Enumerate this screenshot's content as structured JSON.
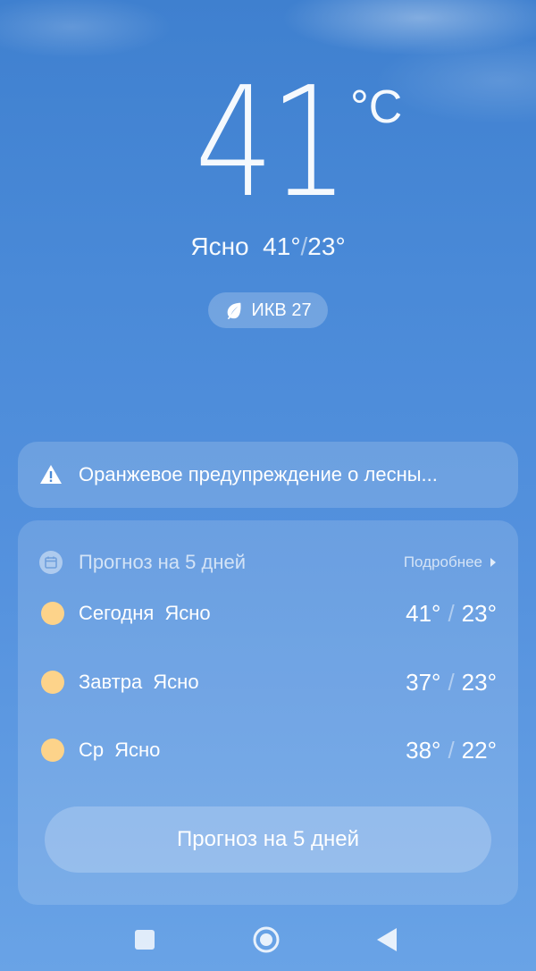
{
  "current": {
    "temperature": "41",
    "unit": "°C",
    "condition": "Ясно",
    "high": "41°",
    "low": "23°"
  },
  "aqi": {
    "label": "ИКВ 27",
    "icon": "leaf-icon"
  },
  "alert": {
    "text": "Оранжевое предупреждение о лесны...",
    "icon": "warning-icon"
  },
  "forecast": {
    "title": "Прогноз на 5 дней",
    "more_label": "Подробнее",
    "icon": "calendar-icon",
    "days": [
      {
        "day": "Сегодня",
        "condition": "Ясно",
        "high": "41°",
        "low": "23°"
      },
      {
        "day": "Завтра",
        "condition": "Ясно",
        "high": "37°",
        "low": "23°"
      },
      {
        "day": "Ср",
        "condition": "Ясно",
        "high": "38°",
        "low": "22°"
      }
    ],
    "button_label": "Прогноз на 5 дней"
  },
  "colors": {
    "sun": "#fdd38a",
    "sky_top": "#3f80cf",
    "sky_bottom": "#69a3e6"
  }
}
